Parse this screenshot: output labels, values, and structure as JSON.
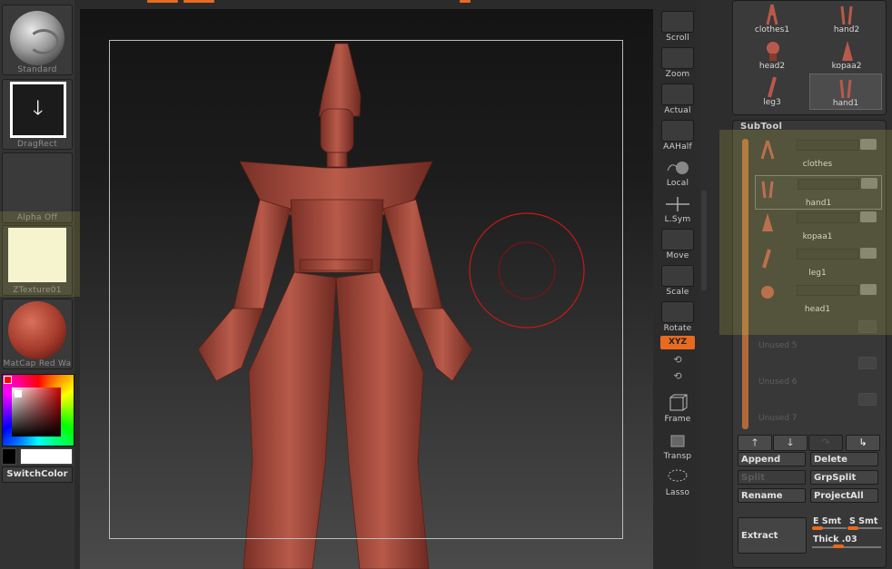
{
  "left_shelf": {
    "brush_label": "Standard",
    "stroke_label": "DragRect",
    "alpha_label": "Alpha  Off",
    "texture_label": "ZTexture01",
    "material_label": "MatCap  Red  Wa",
    "switch_color_label": "SwitchColor",
    "colors": {
      "main": "#ffffff",
      "secondary": "#000000",
      "accent": "#e86a1e"
    }
  },
  "right_tools": [
    {
      "label": "Scroll",
      "icon": "scroll-hand-icon"
    },
    {
      "label": "Zoom",
      "icon": "zoom-magnifier-icon"
    },
    {
      "label": "Actual",
      "icon": "actual-magnifier-icon"
    },
    {
      "label": "AAHalf",
      "icon": "aahalf-magnifier-icon"
    },
    {
      "label": "Local",
      "icon": "local-sphere-icon"
    },
    {
      "label": "L.Sym",
      "icon": "lsym-arrows-icon"
    },
    {
      "label": "Move",
      "icon": "move-hand-icon"
    },
    {
      "label": "Scale",
      "icon": "scale-magnifier-icon"
    },
    {
      "label": "Rotate",
      "icon": "rotate-lock-icon"
    },
    {
      "label": "Frame",
      "icon": "frame-cube-icon"
    },
    {
      "label": "Transp",
      "icon": "transp-cube-icon"
    },
    {
      "label": "Lasso",
      "icon": "lasso-icon"
    }
  ],
  "xyz_label": "XYZ",
  "tool_palette": [
    {
      "label": "clothes1",
      "selected": false
    },
    {
      "label": "hand2",
      "selected": false
    },
    {
      "label": "head2",
      "selected": false
    },
    {
      "label": "kopaa2",
      "selected": false
    },
    {
      "label": "leg3",
      "selected": false
    },
    {
      "label": "hand1",
      "selected": true
    }
  ],
  "subtool": {
    "title": "SubTool",
    "items": [
      {
        "name": "clothes",
        "selected": false,
        "used": true
      },
      {
        "name": "hand1",
        "selected": true,
        "used": true
      },
      {
        "name": "kopaa1",
        "selected": false,
        "used": true
      },
      {
        "name": "leg1",
        "selected": false,
        "used": true
      },
      {
        "name": "head1",
        "selected": false,
        "used": true
      },
      {
        "name": "Unused  5",
        "selected": false,
        "used": false
      },
      {
        "name": "Unused  6",
        "selected": false,
        "used": false
      },
      {
        "name": "Unused  7",
        "selected": false,
        "used": false
      }
    ],
    "buttons": {
      "append": "Append",
      "delete": "Delete",
      "split": "Split",
      "grpsplit": "GrpSplit",
      "rename": "Rename",
      "projectall": "ProjectAll",
      "extract": "Extract",
      "e_smt": "E  Smt",
      "s_smt": "S  Smt",
      "thick": "Thick  .03"
    }
  }
}
